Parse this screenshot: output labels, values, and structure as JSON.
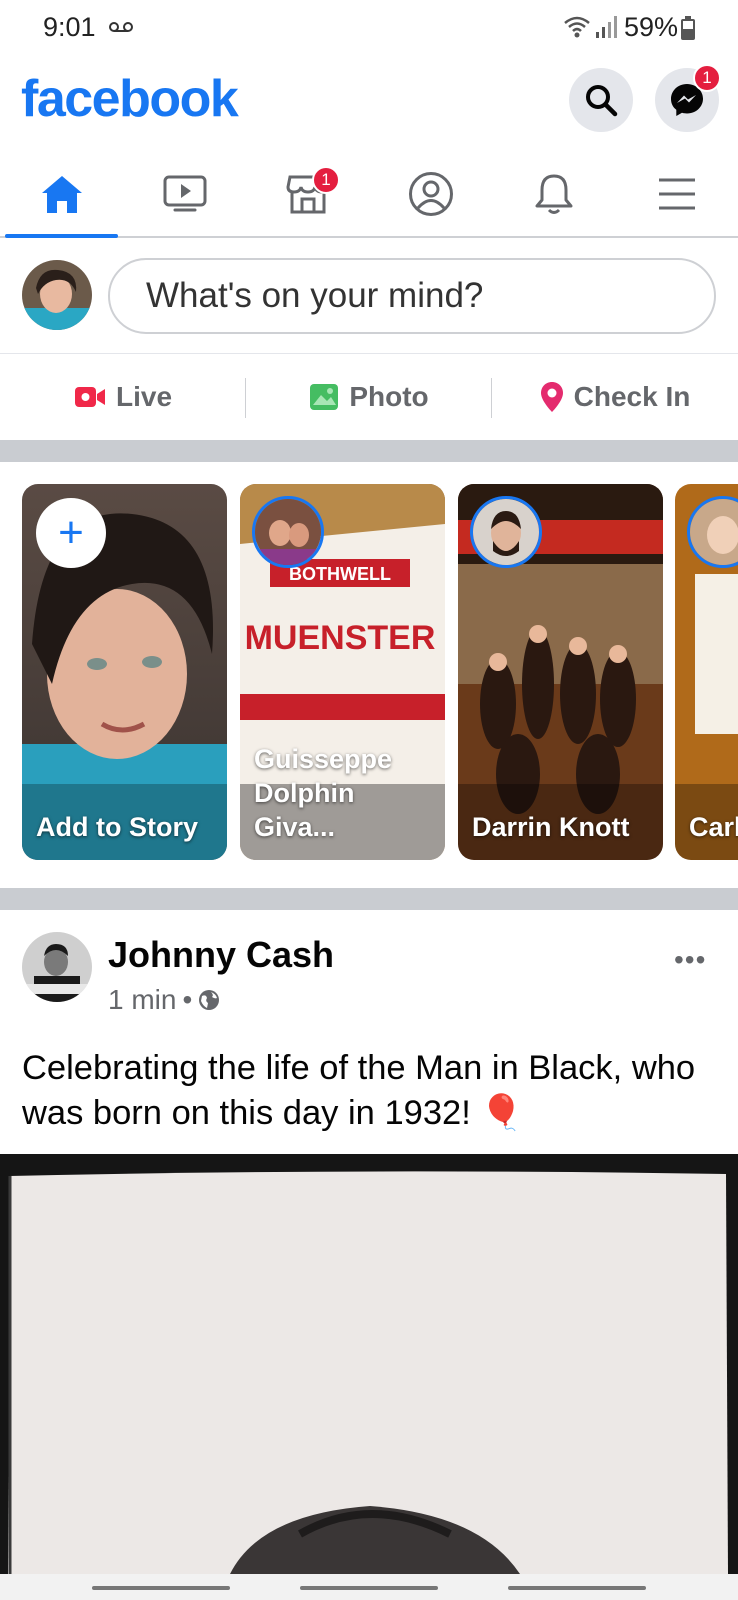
{
  "status_bar": {
    "time": "9:01",
    "battery": "59%"
  },
  "header": {
    "logo": "facebook",
    "messenger_badge": "1"
  },
  "tabs": [
    {
      "name": "home",
      "active": true
    },
    {
      "name": "watch",
      "active": false
    },
    {
      "name": "marketplace",
      "active": false,
      "badge": "1"
    },
    {
      "name": "profile",
      "active": false
    },
    {
      "name": "notifications",
      "active": false
    },
    {
      "name": "menu",
      "active": false
    }
  ],
  "composer": {
    "placeholder": "What's on your mind?"
  },
  "actions": {
    "live": "Live",
    "photo": "Photo",
    "check_in": "Check In"
  },
  "stories": [
    {
      "name": "Add to Story"
    },
    {
      "name": "Guisseppe\nDolphin Giva..."
    },
    {
      "name": "Darrin Knott"
    },
    {
      "name": "Carl"
    }
  ],
  "post": {
    "author": "Johnny Cash",
    "time": "1 min",
    "separator": "•",
    "more": "•••",
    "text": "Celebrating the life of the Man in Black, who was born on this day in 1932! 🎈"
  },
  "colors": {
    "brand": "#1877f2",
    "badge": "#e41e3f",
    "live": "#f02849",
    "photo": "#45bd62",
    "checkin": "#f5533d"
  }
}
